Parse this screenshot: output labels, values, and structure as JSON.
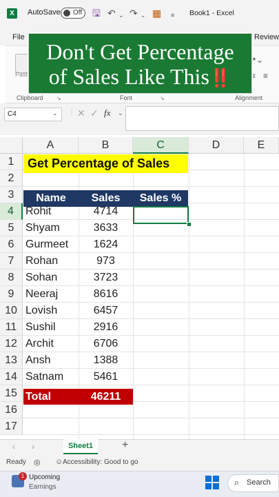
{
  "titlebar": {
    "app_icon": "X",
    "autosave_label": "AutoSave",
    "autosave_state": "Off",
    "doc_title": "Book1  -  Excel",
    "icons": [
      "save-icon",
      "undo-icon",
      "redo-icon",
      "table-icon",
      "customize-dropdown-icon"
    ]
  },
  "ribbon": {
    "tab_file": "File",
    "tab_review": "Review",
    "paste_label": "Paste",
    "group_clipboard": "Clipboard",
    "group_font": "Font",
    "group_alignment": "Alignment"
  },
  "banner": {
    "line1": "Don't Get Percentage",
    "line2": "of Sales Like This",
    "emphasis": "‼️",
    "bg_color": "#1a7a33"
  },
  "formula_bar": {
    "name_box": "C4",
    "fx_label": "fx",
    "formula": ""
  },
  "grid": {
    "columns": [
      "A",
      "B",
      "C",
      "D",
      "E"
    ],
    "rows": [
      "1",
      "2",
      "3",
      "4",
      "5",
      "6",
      "7",
      "8",
      "9",
      "10",
      "11",
      "12",
      "13",
      "14",
      "15",
      "16",
      "17"
    ],
    "selected_cell": "C4",
    "title": "Get Percentage of Sales",
    "headers": {
      "name": "Name",
      "sales": "Sales",
      "sales_pct": "Sales %"
    },
    "records": [
      {
        "name": "Rohit",
        "sales": "4714"
      },
      {
        "name": "Shyam",
        "sales": "3633"
      },
      {
        "name": "Gurmeet",
        "sales": "1624"
      },
      {
        "name": "Rohan",
        "sales": "973"
      },
      {
        "name": "Sohan",
        "sales": "3723"
      },
      {
        "name": "Neeraj",
        "sales": "8616"
      },
      {
        "name": "Lovish",
        "sales": "6457"
      },
      {
        "name": "Sushil",
        "sales": "2916"
      },
      {
        "name": "Archit",
        "sales": "6706"
      },
      {
        "name": "Ansh",
        "sales": "1388"
      },
      {
        "name": "Satnam",
        "sales": "5461"
      }
    ],
    "total_label": "Total",
    "total_value": "46211",
    "colors": {
      "title_fill": "#ffff00",
      "header_fill": "#1f3864",
      "total_fill": "#c00000",
      "accent": "#107c41"
    }
  },
  "sheet_tabs": {
    "active": "Sheet1",
    "add_label": "+"
  },
  "status_bar": {
    "ready": "Ready",
    "accessibility": "Accessibility: Good to go"
  },
  "taskbar": {
    "weather_title": "Upcoming",
    "weather_sub": "Earnings",
    "badge": "1",
    "search_label": "Search"
  }
}
